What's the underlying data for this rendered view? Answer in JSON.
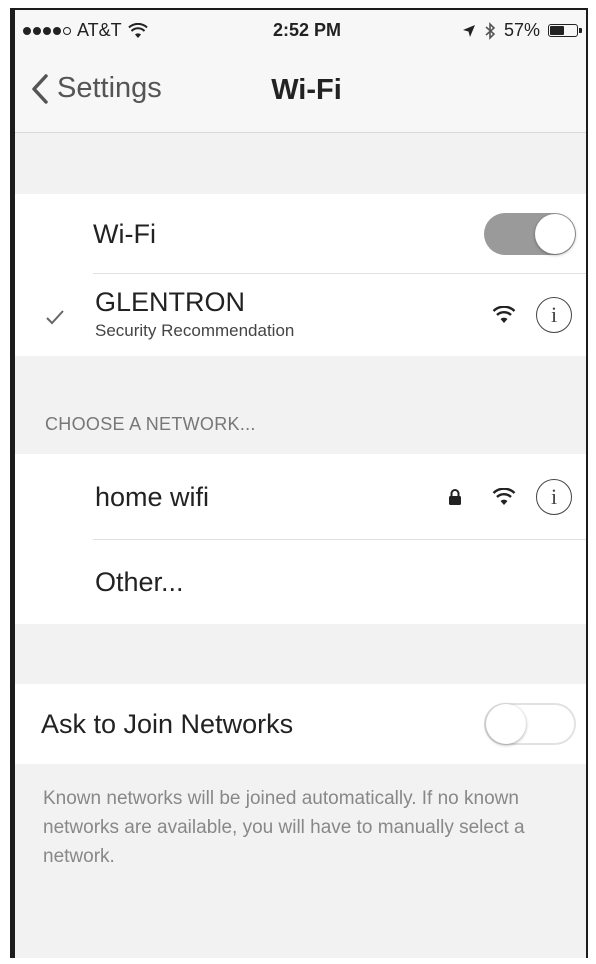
{
  "status_bar": {
    "carrier": "AT&T",
    "time": "2:52 PM",
    "battery": "57%",
    "battery_level": 0.57,
    "signal_dots_filled": 4,
    "signal_dots_total": 5
  },
  "nav": {
    "back_label": "Settings",
    "title": "Wi-Fi"
  },
  "wifi_toggle": {
    "label": "Wi-Fi",
    "on": true
  },
  "connected_network": {
    "name": "GLENTRON",
    "subtitle": "Security Recommendation"
  },
  "choose_network": {
    "header": "CHOOSE A NETWORK...",
    "networks": [
      {
        "name": "home wifi",
        "locked": true
      }
    ],
    "other_label": "Other..."
  },
  "ask_to_join": {
    "label": "Ask to Join Networks",
    "on": false,
    "description": "Known networks will be joined automatically. If no known networks are available, you will have to manually select a network."
  },
  "colors": {
    "toggle_on": "#9a9a9a",
    "background": "#f2f2f2",
    "cell": "#ffffff"
  }
}
